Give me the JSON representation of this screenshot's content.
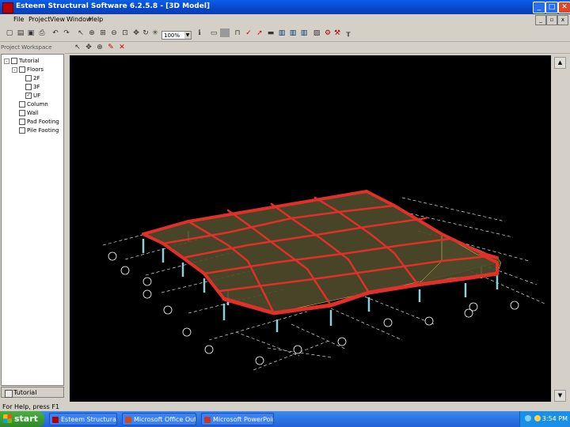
{
  "window": {
    "title": "Esteem Structural Software 6.2.5.8 - [3D Model]"
  },
  "menu": [
    "File",
    "Project",
    "View",
    "Window",
    "Help"
  ],
  "toolbar": {
    "zoom": "100%"
  },
  "explorer": {
    "header": "Project Workspace",
    "tree": [
      {
        "label": "Tutorial",
        "level": 0,
        "toggle": "-",
        "checked": false
      },
      {
        "label": "Floors",
        "level": 1,
        "toggle": "-",
        "checked": false
      },
      {
        "label": "2F",
        "level": 2,
        "toggle": "",
        "checked": false
      },
      {
        "label": "3F",
        "level": 2,
        "toggle": "",
        "checked": false
      },
      {
        "label": "UF",
        "level": 2,
        "toggle": "",
        "checked": true
      },
      {
        "label": "Column",
        "level": 1,
        "toggle": "",
        "checked": false
      },
      {
        "label": "Wall",
        "level": 1,
        "toggle": "",
        "checked": false
      },
      {
        "label": "Pad Footing",
        "level": 1,
        "toggle": "",
        "checked": false
      },
      {
        "label": "Pile Footing",
        "level": 1,
        "toggle": "",
        "checked": false
      }
    ],
    "tab": "Tutorial"
  },
  "status": {
    "text": "For Help, press F1"
  },
  "taskbar": {
    "start": "start",
    "tasks": [
      {
        "label": "Esteem Structural Sof...",
        "color": "#b00000"
      },
      {
        "label": "Microsoft Office Outl...",
        "color": "#d04a1a"
      },
      {
        "label": "Microsoft PowerPoint ...",
        "color": "#c0392b"
      }
    ],
    "clock": "3:54 PM"
  },
  "colors": {
    "slab": "#4d4a2a",
    "beam": "#e0302a",
    "column": "#8fd0d8",
    "grid": "#ffffff",
    "viewport_bg": "#000000"
  }
}
